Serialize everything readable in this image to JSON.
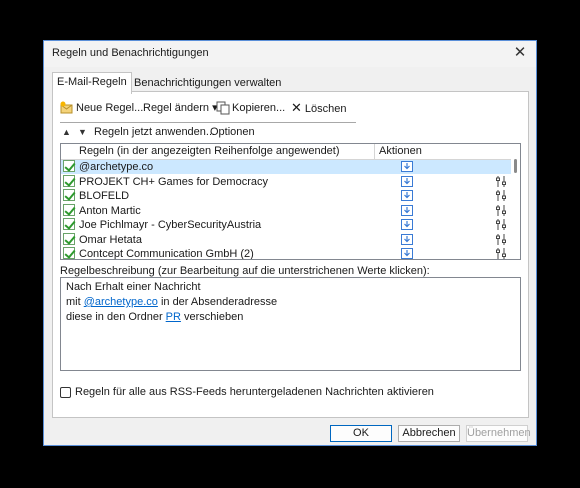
{
  "window": {
    "title": "Regeln und Benachrichtigungen",
    "close": "✕"
  },
  "tabs": [
    {
      "label": "E-Mail-Regeln",
      "active": true
    },
    {
      "label": "Benachrichtigungen verwalten",
      "active": false
    }
  ],
  "toolbar": {
    "new_rule": "Neue Regel...",
    "change_rule": "Regel ändern",
    "change_arrow": "▾",
    "copy": "Kopieren...",
    "delete": "Löschen",
    "delete_glyph": "✕"
  },
  "actions_row": {
    "up": "▲",
    "down": "▼",
    "apply": "Regeln jetzt anwenden...",
    "options": "Optionen"
  },
  "rules_table": {
    "col_rule": "Regeln (in der angezeigten Reihenfolge angewendet)",
    "col_actions": "Aktionen",
    "rows": [
      {
        "name": "@archetype.co",
        "checked": true,
        "selected": true,
        "has_condition_icon": false
      },
      {
        "name": "PROJEKT CH+ Games for Democracy",
        "checked": true,
        "selected": false,
        "has_condition_icon": true
      },
      {
        "name": "BLOFELD",
        "checked": true,
        "selected": false,
        "has_condition_icon": true
      },
      {
        "name": "Anton Martic",
        "checked": true,
        "selected": false,
        "has_condition_icon": true
      },
      {
        "name": "Joe Pichlmayr - CyberSecurityAustria",
        "checked": true,
        "selected": false,
        "has_condition_icon": true
      },
      {
        "name": "Omar Hetata",
        "checked": true,
        "selected": false,
        "has_condition_icon": true
      },
      {
        "name": "Contcept Communication GmbH (2)",
        "checked": true,
        "selected": false,
        "has_condition_icon": true
      }
    ]
  },
  "description": {
    "label": "Regelbeschreibung (zur Bearbeitung auf die unterstrichenen Werte klicken):",
    "line1": "Nach Erhalt einer Nachricht",
    "line2_pre": "mit ",
    "line2_link": "@archetype.co",
    "line2_post": " in der Absenderadresse",
    "line3_pre": "diese in den Ordner ",
    "line3_link": "PR",
    "line3_post": " verschieben"
  },
  "rss_checkbox": {
    "label": "Regeln für alle aus RSS-Feeds heruntergeladenen Nachrichten aktivieren",
    "checked": false
  },
  "buttons": {
    "ok": "OK",
    "cancel": "Abbrechen",
    "apply": "Übernehmen"
  },
  "colors": {
    "accent": "#0067c0",
    "selection": "#cce8ff",
    "check": "#2e9a2e",
    "link": "#0066cc"
  }
}
